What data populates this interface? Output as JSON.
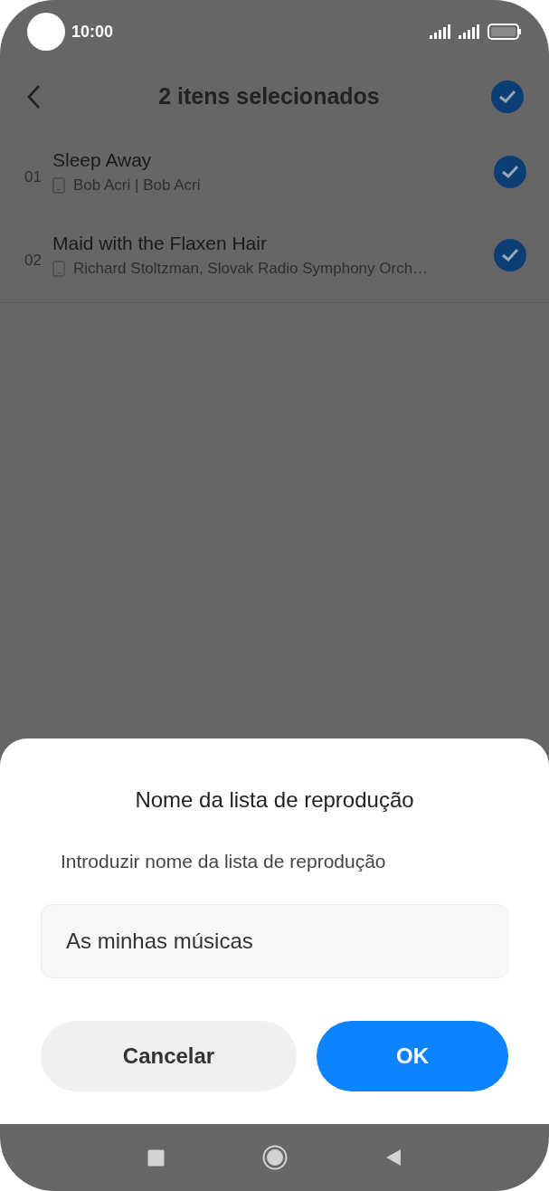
{
  "status_bar": {
    "time": "10:00"
  },
  "header": {
    "title": "2 itens selecionados",
    "all_selected": true
  },
  "songs": [
    {
      "number": "01",
      "title": "Sleep Away",
      "subtitle": "Bob Acri | Bob Acri",
      "selected": true
    },
    {
      "number": "02",
      "title": "Maid with the Flaxen Hair",
      "subtitle": "Richard Stoltzman, Slovak Radio Symphony Orch…",
      "selected": true
    }
  ],
  "dialog": {
    "title": "Nome da lista de reprodução",
    "label": "Introduzir nome da lista de reprodução",
    "input": {
      "value": "As minhas músicas"
    },
    "buttons": [
      {
        "label": "Cancelar",
        "kind": "secondary"
      },
      {
        "label": "OK",
        "kind": "primary"
      }
    ]
  }
}
